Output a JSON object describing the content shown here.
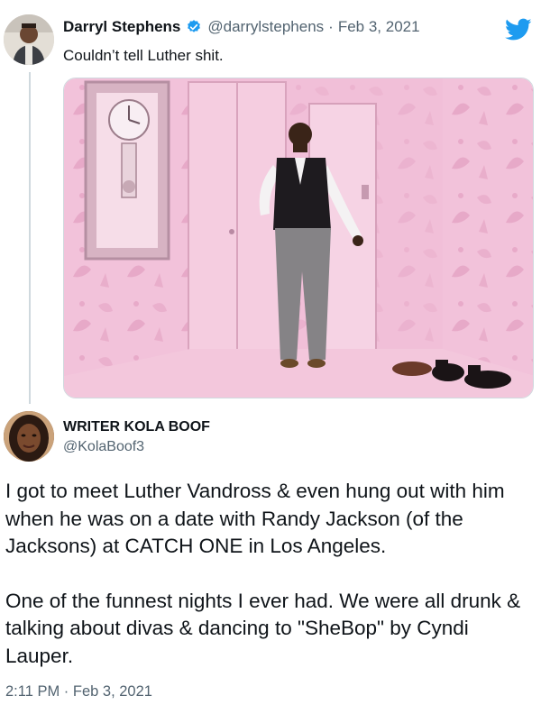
{
  "tweet1": {
    "display_name": "Darryl Stephens",
    "verified_icon": "verified-badge-icon",
    "handle": "@darrylstephens",
    "separator": "·",
    "date": "Feb 3, 2021",
    "text": "Couldn’t tell Luther shit.",
    "media_icon": "photo",
    "brand_icon": "twitter-bird-icon",
    "brand_color": "#1d9bf0"
  },
  "tweet2": {
    "display_name": "WRITER KOLA BOOF",
    "handle": "@KolaBoof3",
    "paragraphs": [
      "I got to meet Luther Vandross & even hung out with him when he was on a date with Randy Jackson (of the Jacksons) at CATCH ONE in Los Angeles.",
      "One of the funnest nights I ever had.  We were all drunk & talking about divas & dancing to \"SheBop\" by Cyndi Lauper."
    ],
    "timestamp": "2:11 PM · Feb 3, 2021"
  },
  "colors": {
    "secondary_text": "#536471",
    "wallpaper_pink": "#f4c6dc",
    "thread_line": "#cfd9de"
  }
}
